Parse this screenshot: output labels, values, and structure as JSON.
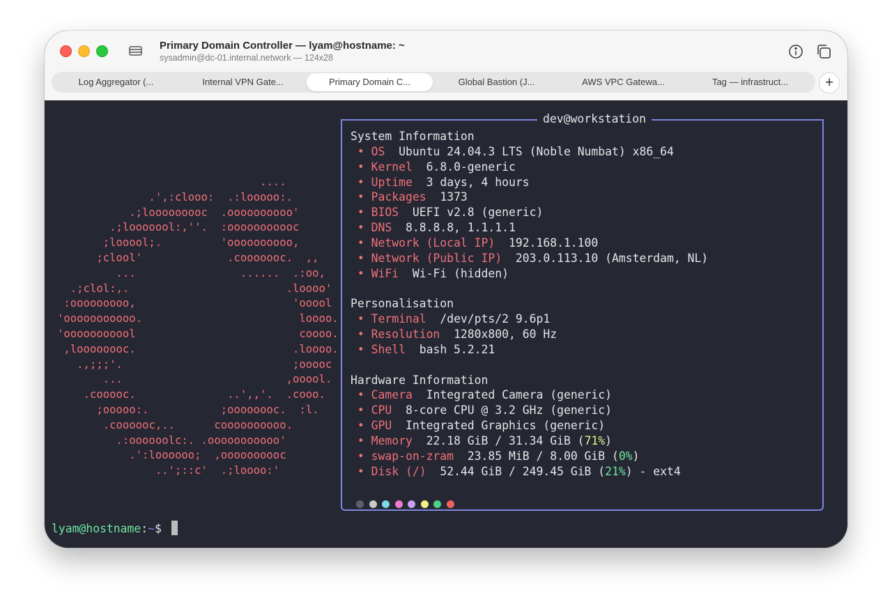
{
  "window": {
    "title": "Primary Domain Controller — lyam@hostname: ~",
    "subtitle": "sysadmin@dc-01.internal.network — 124x28"
  },
  "tabs": [
    {
      "label": "Log Aggregator (..."
    },
    {
      "label": "Internal VPN Gate..."
    },
    {
      "label": "Primary Domain C..."
    },
    {
      "label": "Global Bastion (J..."
    },
    {
      "label": "AWS VPC Gatewa..."
    },
    {
      "label": "Tag — infrastruct..."
    }
  ],
  "active_tab": 2,
  "new_tab_label": "+",
  "ascii_logo_lines": [
    "                               ....",
    "              .',:clooo:  .:looooo:.",
    "           .;looooooooc  .oooooooooo'",
    "        .;looooool:,''.  :ooooooooooc",
    "       ;looool;.         'oooooooooo,",
    "      ;clool'             .cooooooc.  ,,",
    "         ...                ......  .:oo,",
    "  .;clol:,.                        .loooo'",
    " :ooooooooo,                        'ooool",
    "'ooooooooooo.                        loooo.",
    "'ooooooooool                         coooo.",
    " ,loooooooc.                        .loooo.",
    "   .,;;;'.                          ;ooooc",
    "       ...                         ,ooool.",
    "    .cooooc.              ..',,'.  .cooo.",
    "      ;ooooo:.           ;oooooooc.  :l.",
    "       .coooooc,..      coooooooooo.",
    "         .:oooooolc:. .ooooooooooo'",
    "           .':loooooo;  ,oooooooooc",
    "               ..';::c'  .;loooo:'"
  ],
  "fetch": {
    "header": "dev@workstation",
    "bullet": "•",
    "system_title": "System Information",
    "system": [
      {
        "key": "OS",
        "value": "Ubuntu 24.04.3 LTS (Noble Numbat) x86_64"
      },
      {
        "key": "Kernel",
        "value": "6.8.0-generic"
      },
      {
        "key": "Uptime",
        "value": "3 days, 4 hours"
      },
      {
        "key": "Packages",
        "value": "1373"
      },
      {
        "key": "BIOS",
        "value": "UEFI v2.8 (generic)"
      },
      {
        "key": "DNS",
        "value": "8.8.8.8, 1.1.1.1"
      },
      {
        "key": "Network (Local IP)",
        "value": "192.168.1.100"
      },
      {
        "key": "Network (Public IP)",
        "value": "203.0.113.10 (Amsterdam, NL)"
      },
      {
        "key": "WiFi",
        "value": "Wi-Fi (hidden)"
      }
    ],
    "personal_title": "Personalisation",
    "personal": [
      {
        "key": "Terminal",
        "value": "/dev/pts/2 9.6p1"
      },
      {
        "key": "Resolution",
        "value": "1280x800, 60 Hz"
      },
      {
        "key": "Shell",
        "value": "bash 5.2.21"
      }
    ],
    "hardware_title": "Hardware Information",
    "hardware": [
      {
        "key": "Camera",
        "value": "Integrated Camera (generic)"
      },
      {
        "key": "CPU",
        "value": "8-core CPU @ 3.2 GHz (generic)"
      },
      {
        "key": "GPU",
        "value": "Integrated Graphics (generic)"
      },
      {
        "key": "Memory",
        "value": "22.18 GiB / 31.34 GiB (",
        "pct": "71%",
        "suffix": ")"
      },
      {
        "key": "swap-on-zram",
        "value": "23.85 MiB / 8.00 GiB (",
        "pct": "0%",
        "suffix": ")"
      },
      {
        "key": "Disk (/)",
        "value": "52.44 GiB / 249.45 GiB (",
        "pct": "21%",
        "suffix": ") - ext4"
      }
    ],
    "palette": [
      "#5c5f6e",
      "#c8c8c8",
      "#7fd8e8",
      "#f07bd0",
      "#c4a3f5",
      "#f3f08a",
      "#4fd187",
      "#f0605e"
    ]
  },
  "prompt": {
    "user": "lyam@hostname",
    "sep": ":",
    "path": "~",
    "symbol": "$ "
  }
}
